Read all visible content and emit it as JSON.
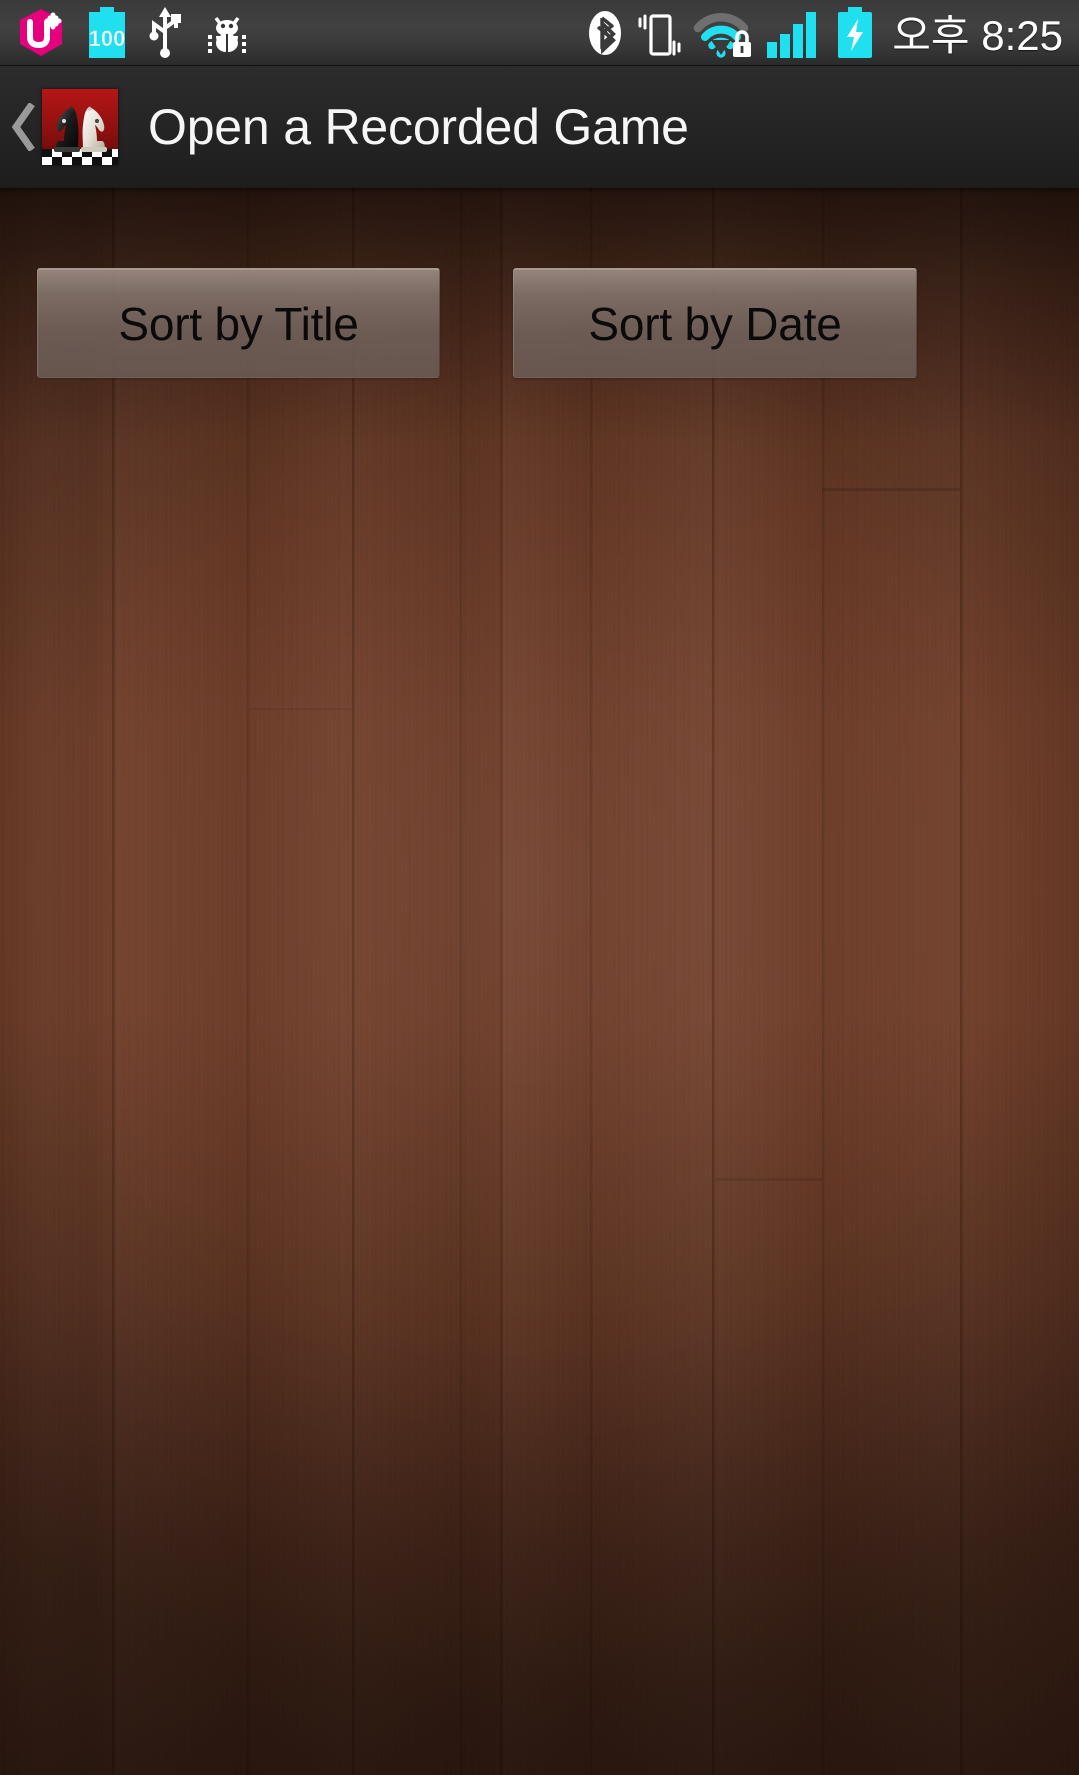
{
  "status_bar": {
    "carrier_logo": "lgu-plus-logo",
    "icons": [
      {
        "name": "lgu-plus-logo-icon",
        "label": "U+"
      },
      {
        "name": "battery-percent-icon",
        "label": "100"
      },
      {
        "name": "usb-icon",
        "label": "USB"
      },
      {
        "name": "debug-bug-icon",
        "label": "USB debugging"
      },
      {
        "name": "bluetooth-icon",
        "label": "Bluetooth"
      },
      {
        "name": "vibrate-mode-icon",
        "label": "Vibrate"
      },
      {
        "name": "wifi-locked-icon",
        "label": "Wi-Fi secured"
      },
      {
        "name": "cellular-signal-icon",
        "label": "Signal"
      },
      {
        "name": "battery-charging-icon",
        "label": "Charging"
      }
    ],
    "battery_level_text": "100",
    "am_pm": "오후",
    "time": "8:25",
    "clock_full": "오후 8:25"
  },
  "action_bar": {
    "back_label": "❮",
    "app_icon_name": "chess-knights-app-icon",
    "title": "Open a Recorded Game"
  },
  "content": {
    "background": "wood-texture",
    "buttons": [
      {
        "name": "sort-by-title-button",
        "label": "Sort by Title"
      },
      {
        "name": "sort-by-date-button",
        "label": "Sort by Date"
      }
    ],
    "empty_list_message": ""
  },
  "colors": {
    "status_bar_bg": "#3a3a3a",
    "action_bar_bg": "#262626",
    "accent_cyan": "#20E0F0",
    "carrier_magenta": "#E6007E",
    "wood_base": "#6f3d28",
    "button_fill": "#70605A",
    "title_text": "#f6f6f6"
  }
}
